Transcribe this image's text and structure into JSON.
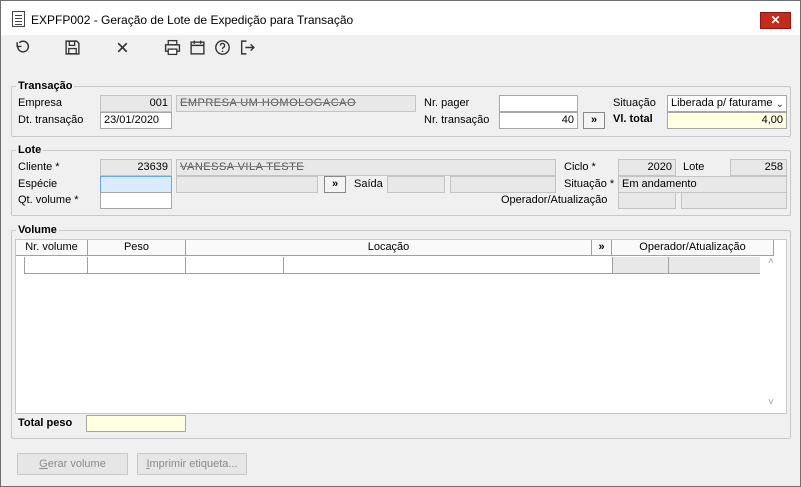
{
  "window": {
    "title": "EXPFP002 - Geração de Lote de Expedição para Transação",
    "close_glyph": "✕"
  },
  "toolbar": {
    "icons": [
      "undo-icon",
      "save-icon",
      "cancel-icon",
      "print-icon",
      "calendar-icon",
      "help-icon",
      "exit-icon"
    ]
  },
  "transacao": {
    "legend": "Transação",
    "empresa_label": "Empresa",
    "empresa_code": "001",
    "empresa_name": "EMPRESA UM HOMOLOGACAO",
    "dt_label": "Dt. transação",
    "dt_value": "23/01/2020",
    "nr_pager_label": "Nr. pager",
    "nr_pager_value": "",
    "nr_transacao_label": "Nr. transação",
    "nr_transacao_value": "40",
    "nr_transacao_btn": "»",
    "situacao_label": "Situação",
    "situacao_value": "Liberada p/ faturame",
    "vl_total_label": "Vl. total",
    "vl_total_value": "4,00"
  },
  "lote": {
    "legend": "Lote",
    "cliente_label": "Cliente *",
    "cliente_code": "23639",
    "cliente_name": "VANESSA VILA TESTE",
    "ciclo_label": "Ciclo *",
    "ciclo_value": "2020",
    "lote_label": "Lote",
    "lote_value": "258",
    "especie_label": "Espécie",
    "especie_value": "",
    "especie_btn": "»",
    "saida_label": "Saída",
    "situacao_label": "Situação *",
    "situacao_value": "Em andamento",
    "qt_label": "Qt. volume *",
    "qt_value": "",
    "operador_label": "Operador/Atualização"
  },
  "volume": {
    "legend": "Volume",
    "columns": [
      "Nr. volume",
      "Peso",
      "Locação",
      "»",
      "Operador/Atualização"
    ],
    "total_peso_label": "Total peso",
    "total_peso_value": ""
  },
  "buttons": {
    "gerar_prefix": "G",
    "gerar_rest": "erar volume",
    "imprimir_prefix": "I",
    "imprimir_rest": "mprimir etiqueta..."
  },
  "colors": {
    "close": "#c42b1c",
    "highlight_yellow": "#ffffe1",
    "focus_blue": "#d9ecff"
  }
}
